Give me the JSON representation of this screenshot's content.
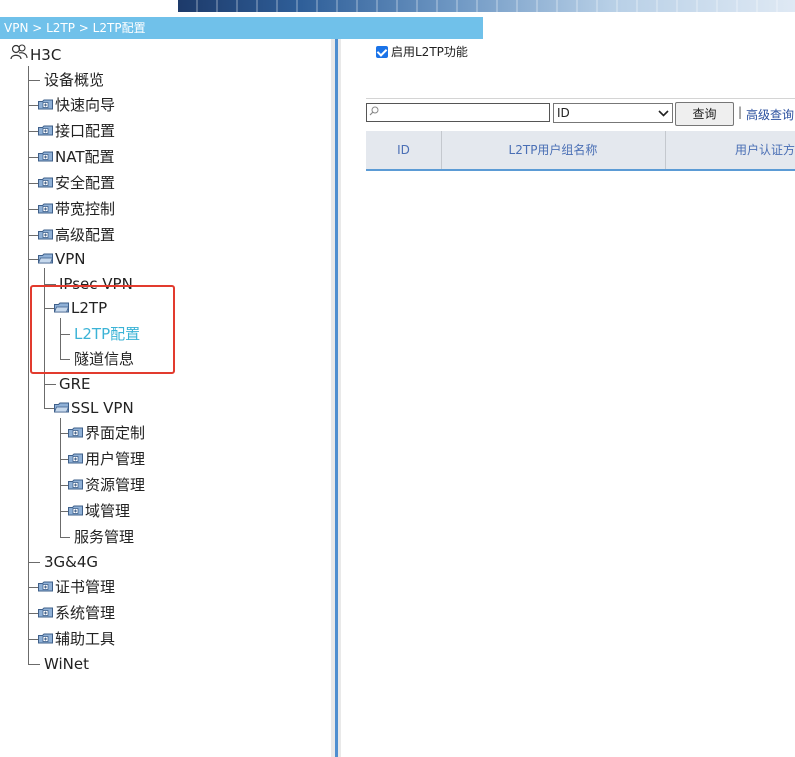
{
  "breadcrumb": "VPN > L2TP > L2TP配置",
  "tree": {
    "root": "H3C",
    "items": [
      {
        "label": "设备概览"
      },
      {
        "label": "快速向导"
      },
      {
        "label": "接口配置"
      },
      {
        "label": "NAT配置"
      },
      {
        "label": "安全配置"
      },
      {
        "label": "带宽控制"
      },
      {
        "label": "高级配置"
      },
      {
        "label": "VPN"
      },
      {
        "label": "IPsec VPN"
      },
      {
        "label": "L2TP"
      },
      {
        "label": "L2TP配置"
      },
      {
        "label": "隧道信息"
      },
      {
        "label": "GRE"
      },
      {
        "label": "SSL VPN"
      },
      {
        "label": "界面定制"
      },
      {
        "label": "用户管理"
      },
      {
        "label": "资源管理"
      },
      {
        "label": "域管理"
      },
      {
        "label": "服务管理"
      },
      {
        "label": "3G&4G"
      },
      {
        "label": "证书管理"
      },
      {
        "label": "系统管理"
      },
      {
        "label": "辅助工具"
      },
      {
        "label": "WiNet"
      }
    ]
  },
  "main": {
    "enable_label": "启用L2TP功能",
    "search_value": "",
    "select_value": "ID",
    "query_button": "查询",
    "advanced_link": "高级查询",
    "columns": [
      "ID",
      "L2TP用户组名称",
      "用户认证方"
    ]
  },
  "colors": {
    "breadcrumb_bg": "#70c1ea",
    "selected_item": "#3bb3d6",
    "highlight_box": "#e23b2e",
    "header_text": "#4a6fb5"
  }
}
